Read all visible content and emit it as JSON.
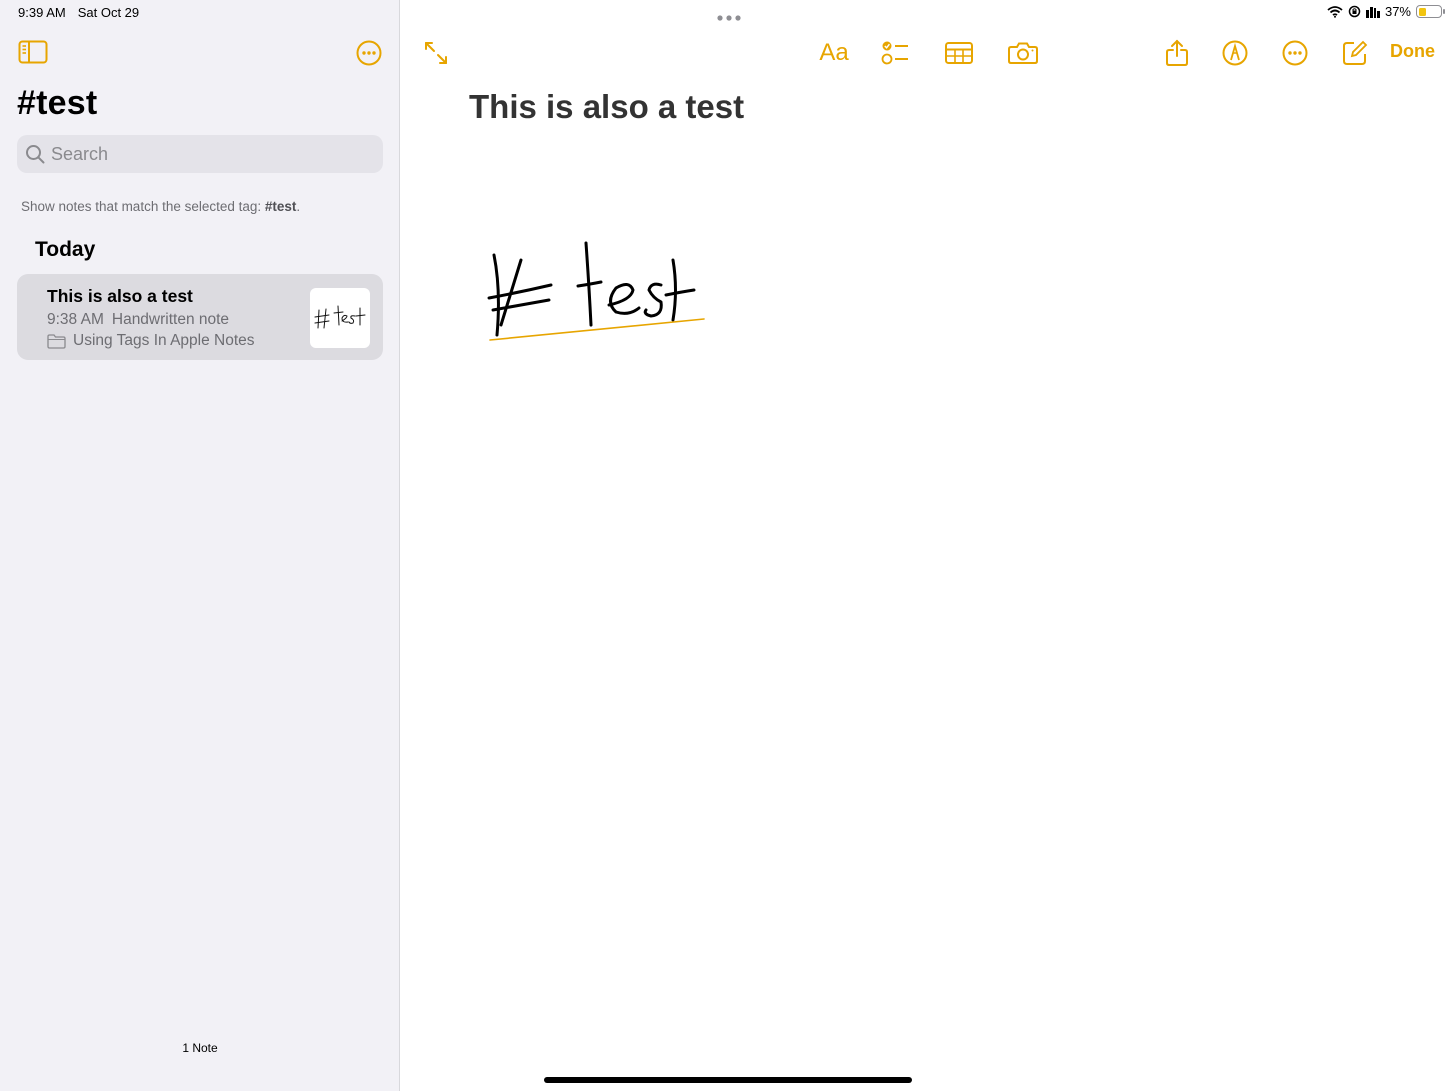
{
  "status_bar": {
    "time": "9:39 AM",
    "date": "Sat Oct 29",
    "battery_percent": "37%",
    "battery_level": 0.37
  },
  "colors": {
    "accent": "#e7a500",
    "sidebar_bg": "#f2f1f6",
    "selected_row_bg": "#dcdbe0"
  },
  "sidebar": {
    "title": "#test",
    "search": {
      "placeholder": "Search",
      "value": ""
    },
    "hint_prefix": "Show notes that match the selected tag: ",
    "hint_tag": "#test",
    "hint_suffix": ".",
    "section": "Today",
    "notes": [
      {
        "title": "This is also a test",
        "time": "9:38 AM",
        "kind": "Handwritten note",
        "folder": "Using Tags In Apple Notes",
        "thumbnail_text": "# test"
      }
    ],
    "count": "1 Note"
  },
  "toolbar": {
    "icons": [
      "expand-icon",
      "format-icon",
      "checklist-icon",
      "table-icon",
      "camera-icon",
      "share-icon",
      "markup-icon",
      "more-icon",
      "compose-icon"
    ],
    "format_label": "Aa",
    "done_label": "Done"
  },
  "editor": {
    "title": "This is also a test",
    "handwriting": "# test"
  }
}
